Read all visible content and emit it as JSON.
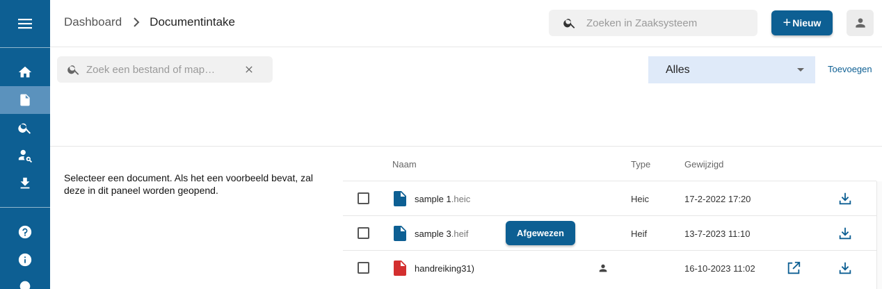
{
  "colors": {
    "brand": "#0d5f93",
    "sidebar_active": "#5b92bd",
    "pdf_red": "#d32f2f",
    "select_bg": "#dfeaf9"
  },
  "sidebar": {
    "menu_icon": "hamburger-icon",
    "items": [
      {
        "icon": "home-icon",
        "active": false
      },
      {
        "icon": "document-icon",
        "active": true
      },
      {
        "icon": "search-icon",
        "active": false
      },
      {
        "icon": "user-search-icon",
        "active": false
      },
      {
        "icon": "download-icon",
        "active": false
      },
      {
        "icon": "help-icon",
        "active": false
      },
      {
        "icon": "info-icon",
        "active": false
      },
      {
        "icon": "circle-icon",
        "active": false
      }
    ]
  },
  "header": {
    "breadcrumb": {
      "root": "Dashboard",
      "current": "Documentintake"
    },
    "search_placeholder": "Zoeken in Zaaksysteem",
    "new_button": {
      "plus": "+",
      "label": "Nieuw"
    }
  },
  "filters": {
    "file_search_placeholder": "Zoek een bestand of map…",
    "select_value": "Alles",
    "add_link": "Toevoegen"
  },
  "preview": {
    "message": "Selecteer een document. Als het een voorbeeld bevat, zal deze in dit paneel worden geopend."
  },
  "table": {
    "headers": {
      "name": "Naam",
      "type": "Type",
      "modified": "Gewijzigd"
    },
    "rows": [
      {
        "name": "sample 1",
        "ext": ".heic",
        "type": "Heic",
        "modified": "17-2-2022 17:20",
        "icon": "file-icon",
        "badge": "",
        "has_person": false,
        "has_open": false
      },
      {
        "name": "sample 3",
        "ext": ".heif",
        "type": "Heif",
        "modified": "13-7-2023 11:10",
        "icon": "file-icon",
        "badge": "Afgewezen",
        "has_person": false,
        "has_open": false
      },
      {
        "name": "handreiking31)",
        "ext": "",
        "type": "",
        "modified": "16-10-2023 11:02",
        "icon": "pdf-file-icon",
        "badge": "",
        "has_person": true,
        "has_open": true
      }
    ]
  }
}
